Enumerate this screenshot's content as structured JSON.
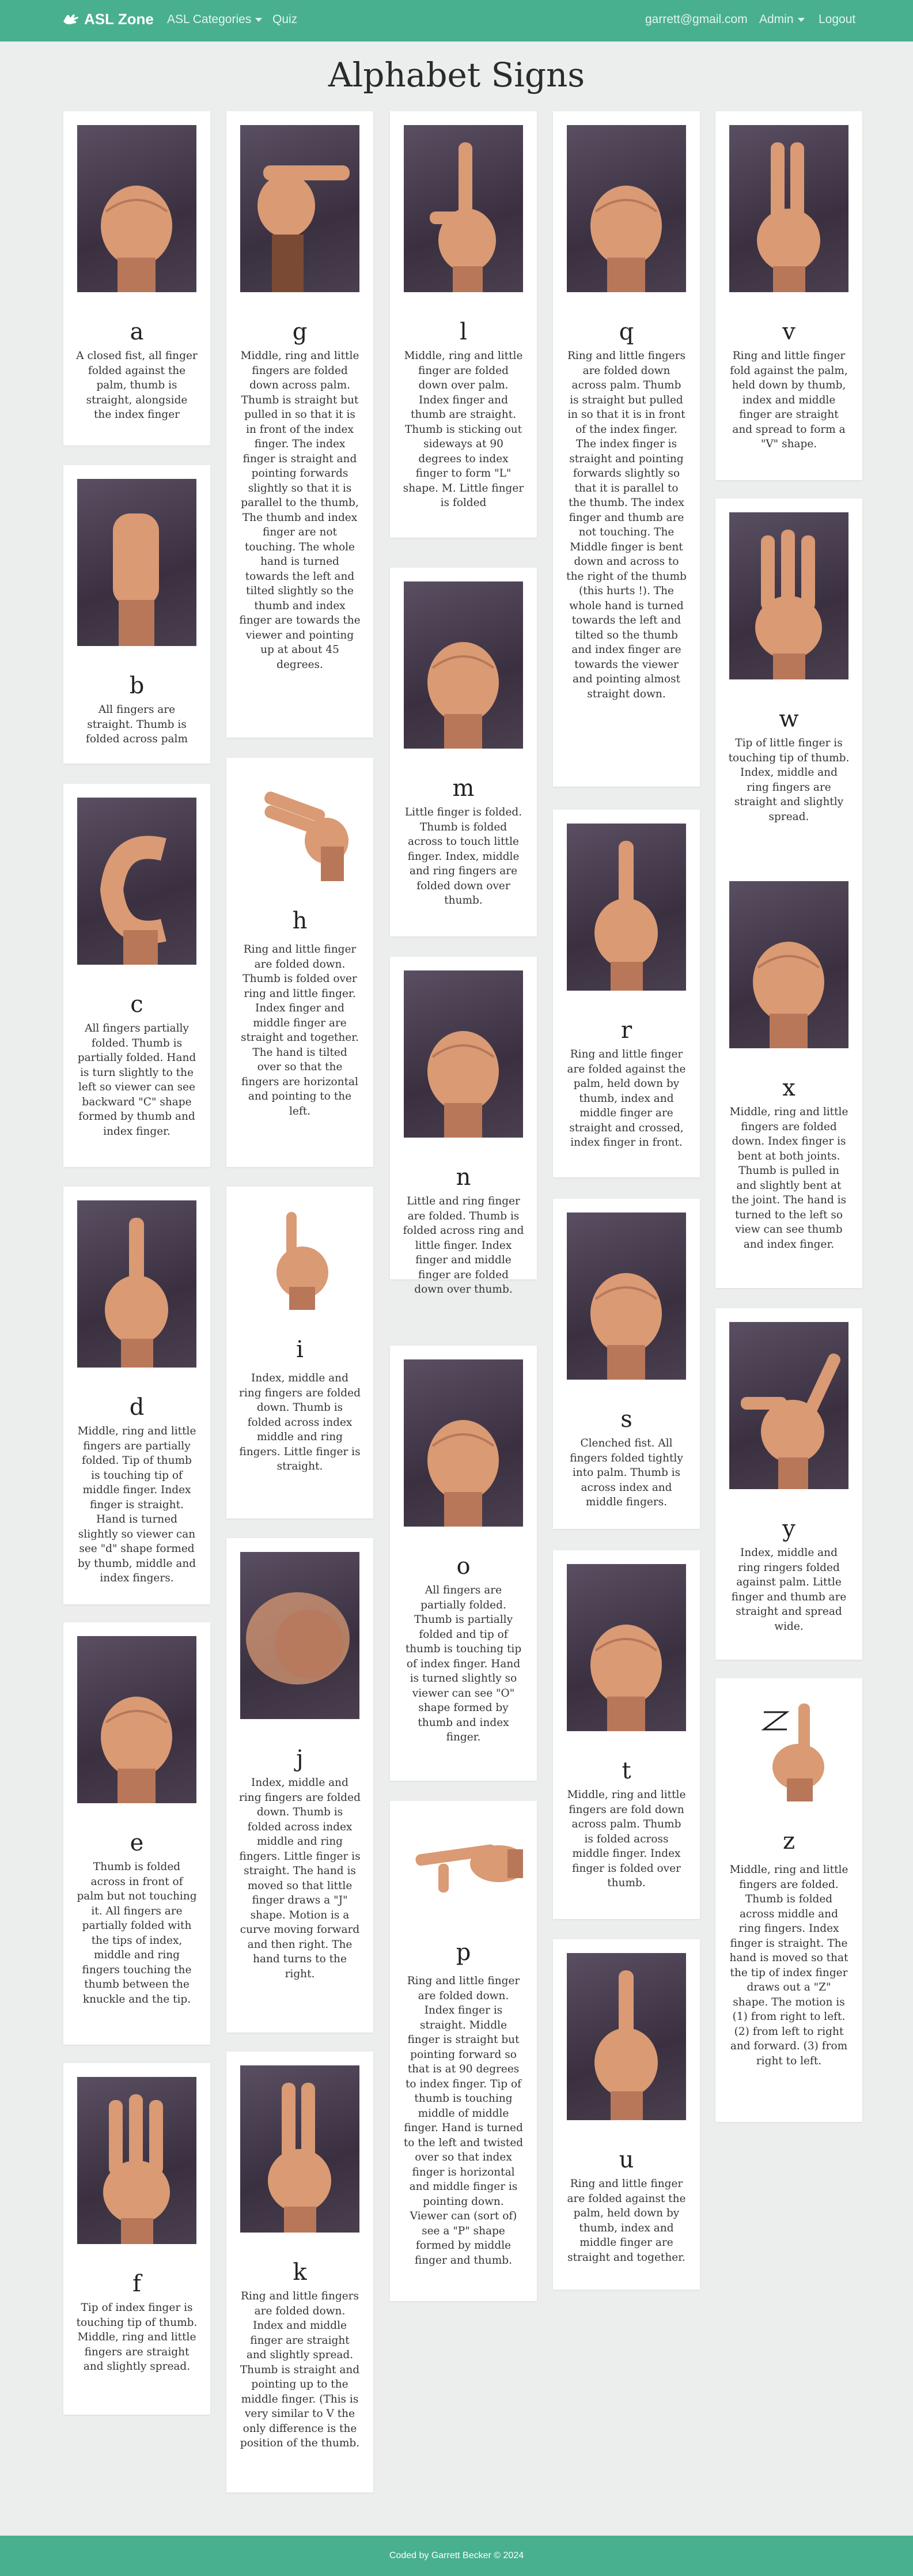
{
  "nav": {
    "brand": "ASL Zone",
    "categories": "ASL Categories",
    "quiz": "Quiz",
    "email": "garrett@gmail.com",
    "admin": "Admin",
    "logout": "Logout"
  },
  "page": {
    "title": "Alphabet Signs"
  },
  "signs": [
    {
      "letter": "a",
      "desc": "A closed fist, all finger folded against the palm, thumb is straight, alongside the index finger"
    },
    {
      "letter": "b",
      "desc": "All fingers are straight. Thumb is folded across palm"
    },
    {
      "letter": "c",
      "desc": "All fingers partially folded. Thumb is partially folded. Hand is turn slightly to the left so viewer can see backward \"C\" shape formed by thumb and index finger."
    },
    {
      "letter": "d",
      "desc": "Middle, ring and little fingers are partially folded. Tip of thumb is touching tip of middle finger. Index finger is straight. Hand is turned slightly so viewer can see \"d\" shape formed by thumb, middle and index fingers."
    },
    {
      "letter": "e",
      "desc": "Thumb is folded across in front of palm but not touching it. All fingers are partially folded with the tips of index, middle and ring fingers touching the thumb between the knuckle and the tip."
    },
    {
      "letter": "f",
      "desc": "Tip of index finger is touching tip of thumb. Middle, ring and little fingers are straight and slightly spread."
    },
    {
      "letter": "g",
      "desc": "Middle, ring and little fingers are folded down across palm. Thumb is straight but pulled in so that it is in front of the index finger. The index finger is straight and pointing forwards slightly so that it is parallel to the thumb, The thumb and index finger are not touching. The whole hand is turned towards the left and tilted slightly so the thumb and index finger are towards the viewer and pointing up at about 45 degrees."
    },
    {
      "letter": "h",
      "desc": "Ring and little finger are folded down. Thumb is folded over ring and little finger. Index finger and middle finger are straight and together. The hand is tilted over so that the fingers are horizontal and pointing to the left."
    },
    {
      "letter": "i",
      "desc": "Index, middle and ring fingers are folded down. Thumb is folded across index middle and ring fingers. Little finger is straight."
    },
    {
      "letter": "j",
      "desc": "Index, middle and ring fingers are folded down. Thumb is folded across index middle and ring fingers. Little finger is straight. The hand is moved so that little finger draws a \"J\" shape. Motion is a curve moving forward and then right. The hand turns to the right."
    },
    {
      "letter": "k",
      "desc": "Ring and little fingers are folded down. Index and middle finger are straight and slightly spread. Thumb is straight and pointing up to the middle finger. (This is very similar to V the only difference is the position of the thumb."
    },
    {
      "letter": "l",
      "desc": "Middle, ring and little finger are folded down over palm. Index finger and thumb are straight. Thumb is sticking out sideways at 90 degrees to index finger to form \"L\" shape. M. Little finger is folded"
    },
    {
      "letter": "m",
      "desc": "Little finger is folded. Thumb is folded across to touch little finger. Index, middle and ring fingers are folded down over thumb."
    },
    {
      "letter": "n",
      "desc": "Little and ring finger are folded. Thumb is folded across ring and little finger. Index finger and middle finger are folded down over thumb."
    },
    {
      "letter": "o",
      "desc": "All fingers are partially folded. Thumb is partially folded and tip of thumb is touching tip of index finger. Hand is turned slightly so viewer can see \"O\" shape formed by thumb and index finger."
    },
    {
      "letter": "p",
      "desc": "Ring and little finger are folded down. Index finger is straight. Middle finger is straight but pointing forward so that is at 90 degrees to index finger. Tip of thumb is touching middle of middle finger. Hand is turned to the left and twisted over so that index finger is horizontal and middle finger is pointing down. Viewer can (sort of) see a \"P\" shape formed by middle finger and thumb."
    },
    {
      "letter": "q",
      "desc": "Ring and little fingers are folded down across palm. Thumb is straight but pulled in so that it is in front of the index finger. The index finger is straight and pointing forwards slightly so that it is parallel to the thumb. The index finger and thumb are not touching. The Middle finger is bent down and across to the right of the thumb (this hurts !). The whole hand is turned towards the left and tilted so the thumb and index finger are towards the viewer and pointing almost straight down."
    },
    {
      "letter": "r",
      "desc": "Ring and little finger are folded against the palm, held down by thumb, index and middle finger are straight and crossed, index finger in front."
    },
    {
      "letter": "s",
      "desc": "Clenched fist. All fingers folded tightly into palm. Thumb is across index and middle fingers."
    },
    {
      "letter": "t",
      "desc": "Middle, ring and little fingers are fold down across palm. Thumb is folded across middle finger. Index finger is folded over thumb."
    },
    {
      "letter": "u",
      "desc": "Ring and little finger are folded against the palm, held down by thumb, index and middle finger are straight and together."
    },
    {
      "letter": "v",
      "desc": "Ring and little finger fold against the palm, held down by thumb, index and middle finger are straight and spread to form a \"V\" shape."
    },
    {
      "letter": "w",
      "desc": "Tip of little finger is touching tip of thumb. Index, middle and ring fingers are straight and slightly spread."
    },
    {
      "letter": "x",
      "desc": "Middle, ring and little fingers are folded down. Index finger is bent at both joints. Thumb is pulled in and slightly bent at the joint. The hand is turned to the left so view can see thumb and index finger."
    },
    {
      "letter": "y",
      "desc": "Index, middle and ring ringers folded against palm. Little finger and thumb are straight and spread wide."
    },
    {
      "letter": "z",
      "desc": "Middle, ring and little fingers are folded. Thumb is folded across middle and ring fingers. Index finger is straight. The hand is moved so that the tip of index finger draws out a \"Z\" shape. The motion is (1) from right to left. (2) from left to right and forward. (3) from right to left."
    }
  ],
  "footer": {
    "text": "Coded by Garrett Becker © 2024"
  }
}
